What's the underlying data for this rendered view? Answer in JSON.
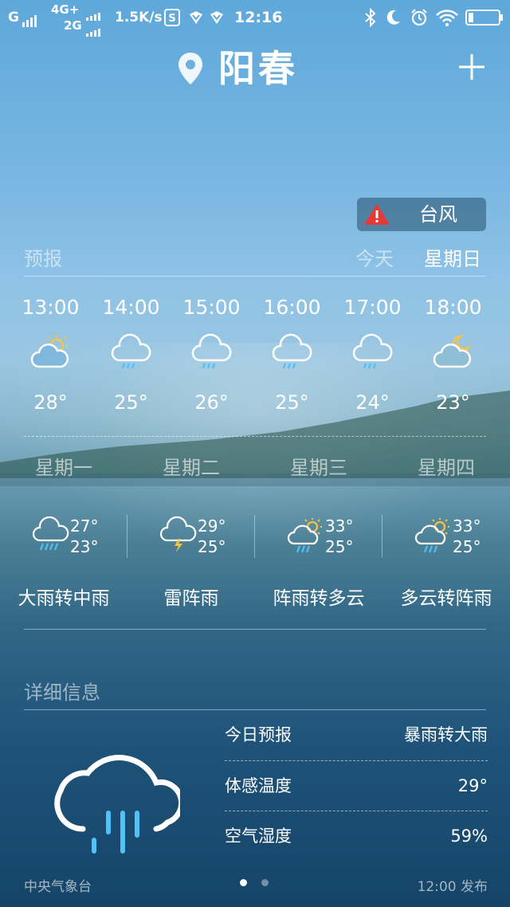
{
  "status_bar": {
    "carrier1": "G",
    "net_type_top": "4G+",
    "net_type_bottom": "2G",
    "speed": "1.5K/s",
    "time": "12:16"
  },
  "header": {
    "city": "阳春"
  },
  "alert": {
    "label": "台风"
  },
  "forecast": {
    "section_label": "预报",
    "today_label": "今天",
    "weekday_label": "星期日",
    "hours": [
      {
        "time": "13:00",
        "temp": "28°",
        "icon": "sun-cloud-icon"
      },
      {
        "time": "14:00",
        "temp": "25°",
        "icon": "cloud-rain-icon"
      },
      {
        "time": "15:00",
        "temp": "26°",
        "icon": "cloud-rain-icon"
      },
      {
        "time": "16:00",
        "temp": "25°",
        "icon": "cloud-rain-icon"
      },
      {
        "time": "17:00",
        "temp": "24°",
        "icon": "cloud-rain-icon"
      },
      {
        "time": "18:00",
        "temp": "23°",
        "icon": "moon-cloud-icon"
      }
    ]
  },
  "daily": [
    {
      "day": "星期一",
      "high": "27°",
      "low": "23°",
      "desc": "大雨转中雨",
      "icon": "heavy-rain-icon"
    },
    {
      "day": "星期二",
      "high": "29°",
      "low": "25°",
      "desc": "雷阵雨",
      "icon": "thunderstorm-icon"
    },
    {
      "day": "星期三",
      "high": "33°",
      "low": "25°",
      "desc": "阵雨转多云",
      "icon": "sun-shower-icon"
    },
    {
      "day": "星期四",
      "high": "33°",
      "low": "25°",
      "desc": "多云转阵雨",
      "icon": "sun-shower-icon"
    }
  ],
  "details": {
    "section_label": "详细信息",
    "rows": [
      {
        "key": "今日预报",
        "value": "暴雨转大雨"
      },
      {
        "key": "体感温度",
        "value": "29°"
      },
      {
        "key": "空气湿度",
        "value": "59%"
      }
    ]
  },
  "footer": {
    "source": "中央气象台",
    "published": "12:00 发布",
    "page_count": 2,
    "active_page": 1
  },
  "colors": {
    "accent_rain": "#4fc3f7",
    "sun": "#f6c343",
    "alert_red": "#e53935",
    "lightning": "#f6c343"
  }
}
